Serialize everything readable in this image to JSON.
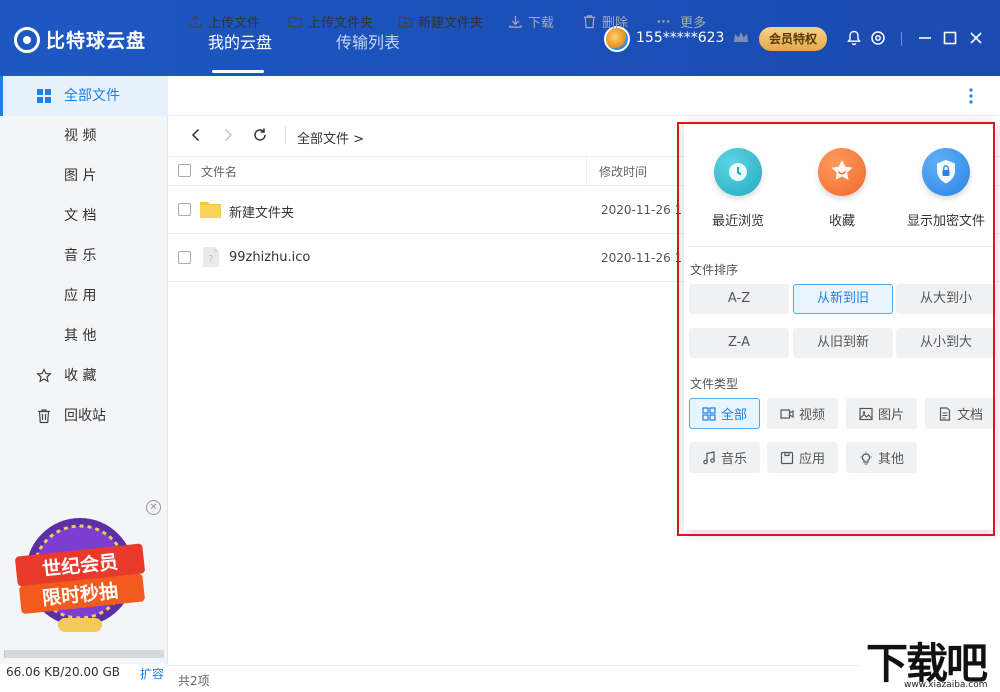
{
  "header": {
    "logo_text": "比特球云盘",
    "tabs": [
      {
        "label": "我的云盘",
        "active": true
      },
      {
        "label": "传输列表",
        "active": false
      }
    ],
    "user": "155*****623",
    "vip_button": "会员特权",
    "brand_color": "#1d58c2"
  },
  "sidebar": {
    "items": [
      {
        "label": "全部文件",
        "icon": "grid-icon",
        "active": true
      },
      {
        "label": "视 频",
        "icon": ""
      },
      {
        "label": "图 片",
        "icon": ""
      },
      {
        "label": "文 档",
        "icon": ""
      },
      {
        "label": "音 乐",
        "icon": ""
      },
      {
        "label": "应 用",
        "icon": ""
      },
      {
        "label": "其 他",
        "icon": ""
      },
      {
        "label": "收 藏",
        "icon": "star-icon"
      },
      {
        "label": "回收站",
        "icon": "trash-icon"
      }
    ],
    "ad_text": [
      "世纪会员",
      "限时秒抽"
    ],
    "storage": {
      "text": "66.06 KB/20.00 GB",
      "used_fraction": 3.3e-06
    },
    "expand_label": "扩容"
  },
  "toolbar": {
    "upload_file": "上传文件",
    "upload_folder": "上传文件夹",
    "new_folder": "新建文件夹",
    "download": "下载",
    "delete": "删除",
    "more": "更多"
  },
  "path": {
    "current": "全部文件 >"
  },
  "table": {
    "columns": [
      "文件名",
      "修改时间"
    ],
    "rows": [
      {
        "name": "新建文件夹",
        "type": "folder",
        "date": "2020-11-26 1"
      },
      {
        "name": "99zhizhu.ico",
        "type": "file",
        "date": "2020-11-26 1"
      }
    ]
  },
  "footer": {
    "count": "共2项"
  },
  "popup": {
    "quick": [
      {
        "label": "最近浏览",
        "icon": "clock-icon",
        "color": "#2bb5c9"
      },
      {
        "label": "收藏",
        "icon": "star-icon",
        "color": "#f2773a"
      },
      {
        "label": "显示加密文件",
        "icon": "shield-icon",
        "color": "#2d8be6"
      }
    ],
    "sort_title": "文件排序",
    "sort_options": [
      "A-Z",
      "从新到旧",
      "从大到小",
      "Z-A",
      "从旧到新",
      "从小到大"
    ],
    "sort_selected": "从新到旧",
    "type_title": "文件类型",
    "type_options": [
      "全部",
      "视频",
      "图片",
      "文档",
      "音乐",
      "应用",
      "其他"
    ],
    "type_selected": "全部"
  },
  "watermark": {
    "text": "下载吧",
    "url": "www.xiazaiba.com"
  }
}
